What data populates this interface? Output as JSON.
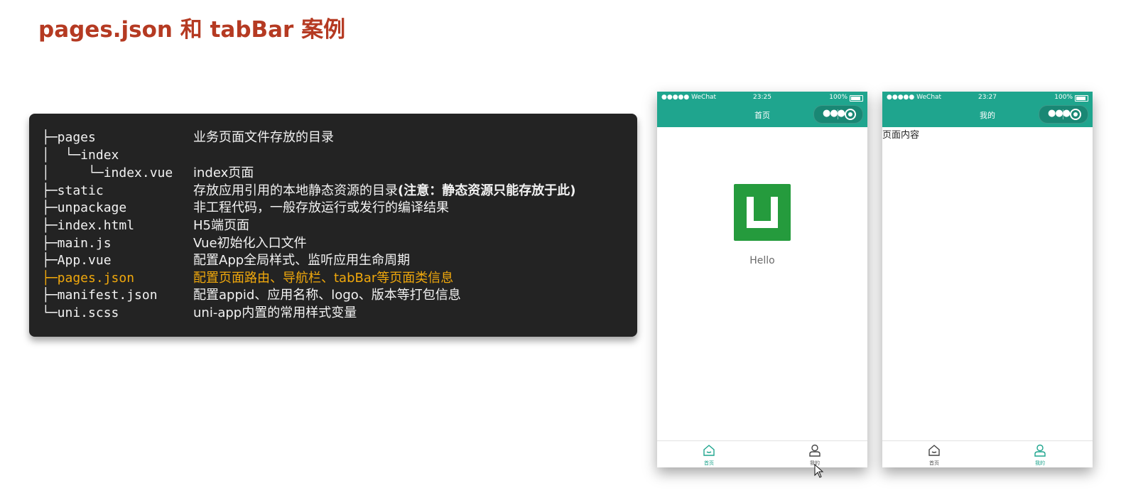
{
  "slide": {
    "title": "pages.json 和 tabBar 案例"
  },
  "tree": [
    {
      "path": "├─pages",
      "desc": "业务页面文件存放的目录"
    },
    {
      "path": "│  └─index",
      "desc": ""
    },
    {
      "path": "│     └─index.vue",
      "desc": "index页面"
    },
    {
      "path": "├─static",
      "desc": "存放应用引用的本地静态资源的目录",
      "desc_bold": "(注意：静态资源只能存放于此)"
    },
    {
      "path": "├─unpackage",
      "desc": "非工程代码，一般存放运行或发行的编译结果"
    },
    {
      "path": "├─index.html",
      "desc": "H5端页面"
    },
    {
      "path": "├─main.js",
      "desc": "Vue初始化入口文件"
    },
    {
      "path": "├─App.vue",
      "desc": "配置App全局样式、监听应用生命周期"
    },
    {
      "path": "├─pages.json",
      "desc": "配置页面路由、导航栏、tabBar等页面类信息",
      "highlight": true,
      "highlight_color": "#f0a80c"
    },
    {
      "path": "├─manifest.json",
      "desc": "配置appid、应用名称、logo、版本等打包信息"
    },
    {
      "path": "└─uni.scss",
      "desc": "uni-app内置的常用样式变量"
    }
  ],
  "phone_home": {
    "status_carrier": "●●●●● WeChat",
    "status_time": "23:25",
    "status_battery": "100%",
    "nav_title": "首页",
    "hello_text": "Hello",
    "tabs": [
      {
        "label": "首页",
        "icon": "home-icon",
        "active": true
      },
      {
        "label": "我的",
        "icon": "user-icon",
        "active": false
      }
    ]
  },
  "phone_mine": {
    "status_carrier": "●●●●● WeChat",
    "status_time": "23:27",
    "status_battery": "100%",
    "nav_title": "我的",
    "page_content": "页面内容",
    "tabs": [
      {
        "label": "首页",
        "icon": "home-icon",
        "active": false
      },
      {
        "label": "我的",
        "icon": "user-icon",
        "active": true
      }
    ]
  },
  "colors": {
    "title": "#b53a22",
    "nav": "#1fa58e",
    "highlight": "#f0a80c",
    "panel": "#232323",
    "logo": "#259b3d"
  }
}
